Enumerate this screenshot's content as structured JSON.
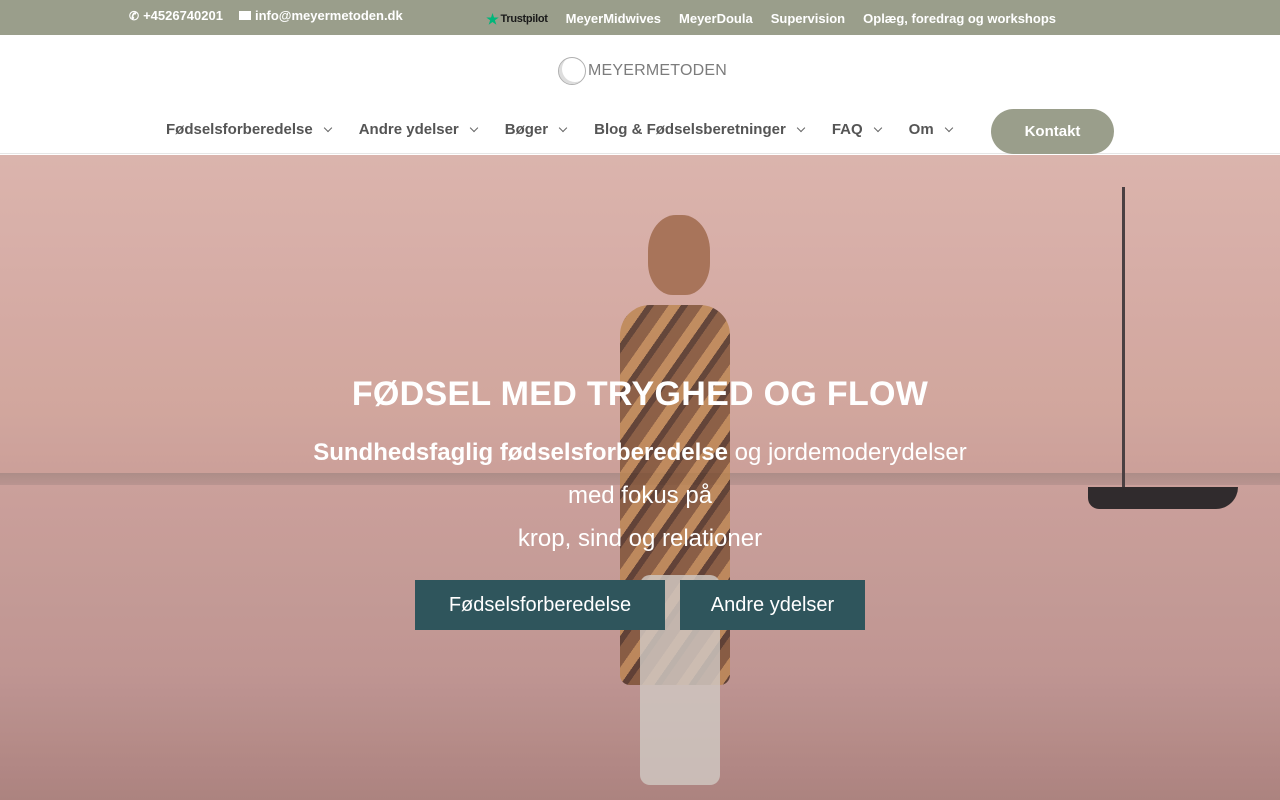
{
  "topbar": {
    "phone": "+4526740201",
    "email": "info@meyermetoden.dk",
    "trustpilot": "Trustpilot",
    "links": [
      "MeyerMidwives",
      "MeyerDoula",
      "Supervision",
      "Oplæg, foredrag og workshops"
    ]
  },
  "header": {
    "logo_text": "MEYERMETODEN",
    "nav": [
      {
        "label": "Fødselsforberedelse"
      },
      {
        "label": "Andre ydelser"
      },
      {
        "label": "Bøger"
      },
      {
        "label": "Blog & Fødselsberetninger"
      },
      {
        "label": "FAQ"
      },
      {
        "label": "Om"
      }
    ],
    "contact_button": "Kontakt"
  },
  "hero": {
    "title": "FØDSEL MED TRYGHED OG FLOW",
    "subtitle_bold": "Sundhedsfaglig fødselsforberedelse",
    "subtitle_rest": " og jordemoderydelser",
    "subtitle_line2": "med fokus på",
    "subtitle_line3": "krop, sind og relationer",
    "buttons": [
      "Fødselsforberedelse",
      "Andre ydelser"
    ]
  },
  "colors": {
    "topbar_bg": "#9a9e8b",
    "accent_button": "#2f555c",
    "nav_text": "#555555"
  }
}
